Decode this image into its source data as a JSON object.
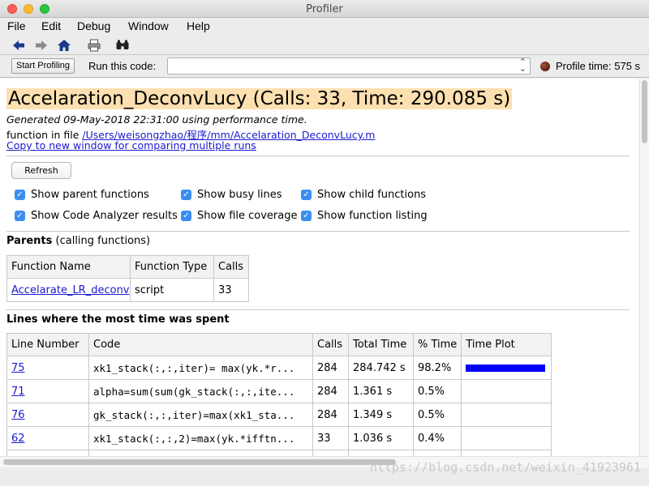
{
  "window": {
    "title": "Profiler"
  },
  "menu": [
    "File",
    "Edit",
    "Debug",
    "Window",
    "Help"
  ],
  "toolbar": {
    "icons": [
      "back-arrow-icon",
      "forward-arrow-icon",
      "home-icon",
      "print-icon",
      "find-icon"
    ]
  },
  "runbar": {
    "start_label": "Start Profiling",
    "run_label": "Run this code:",
    "run_value": "",
    "profile_time": "Profile time: 575 s"
  },
  "header": {
    "title": "Accelaration_DeconvLucy (Calls: 33, Time: 290.085 s)",
    "generated": "Generated 09-May-2018 22:31:00 using performance time.",
    "file_prefix": "function in file ",
    "file_path": "/Users/weisongzhao/程序/mm/Accelaration_DeconvLucy.m",
    "copy_link": "Copy to new window for comparing multiple runs"
  },
  "refresh_label": "Refresh",
  "options": [
    {
      "label": "Show parent functions",
      "checked": true
    },
    {
      "label": "Show busy lines",
      "checked": true
    },
    {
      "label": "Show child functions",
      "checked": true
    },
    {
      "label": "Show Code Analyzer results",
      "checked": true
    },
    {
      "label": "Show file coverage",
      "checked": true
    },
    {
      "label": "Show function listing",
      "checked": true
    }
  ],
  "parents": {
    "heading_bold": "Parents",
    "heading_rest": " (calling functions)",
    "columns": [
      "Function Name",
      "Function Type",
      "Calls"
    ],
    "rows": [
      {
        "name": "Accelarate_LR_deconv",
        "type": "script",
        "calls": "33"
      }
    ]
  },
  "busy_lines": {
    "heading": "Lines where the most time was spent",
    "columns": [
      "Line Number",
      "Code",
      "Calls",
      "Total Time",
      "% Time",
      "Time Plot"
    ],
    "rows": [
      {
        "line": "75",
        "code": "xk1_stack(:,:,iter)= max(yk.*r...",
        "calls": "284",
        "total": "284.742 s",
        "pct": "98.2%",
        "plot": 0.982
      },
      {
        "line": "71",
        "code": "alpha=sum(sum(gk_stack(:,:,ite...",
        "calls": "284",
        "total": "1.361 s",
        "pct": "0.5%",
        "plot": 0.005
      },
      {
        "line": "76",
        "code": "gk_stack(:,:,iter)=max(xk1_sta...",
        "calls": "284",
        "total": "1.349 s",
        "pct": "0.5%",
        "plot": 0.005
      },
      {
        "line": "62",
        "code": "xk1_stack(:,:,2)=max(yk.*ifftn...",
        "calls": "33",
        "total": "1.036 s",
        "pct": "0.4%",
        "plot": 0.004
      }
    ]
  },
  "watermark": "https://blog.csdn.net/weixin_41923961",
  "colors": {
    "title_highlight": "#fde0b0",
    "bar": "#0000ff",
    "link": "#1a1ad0",
    "checkbox": "#3b8ef0"
  }
}
